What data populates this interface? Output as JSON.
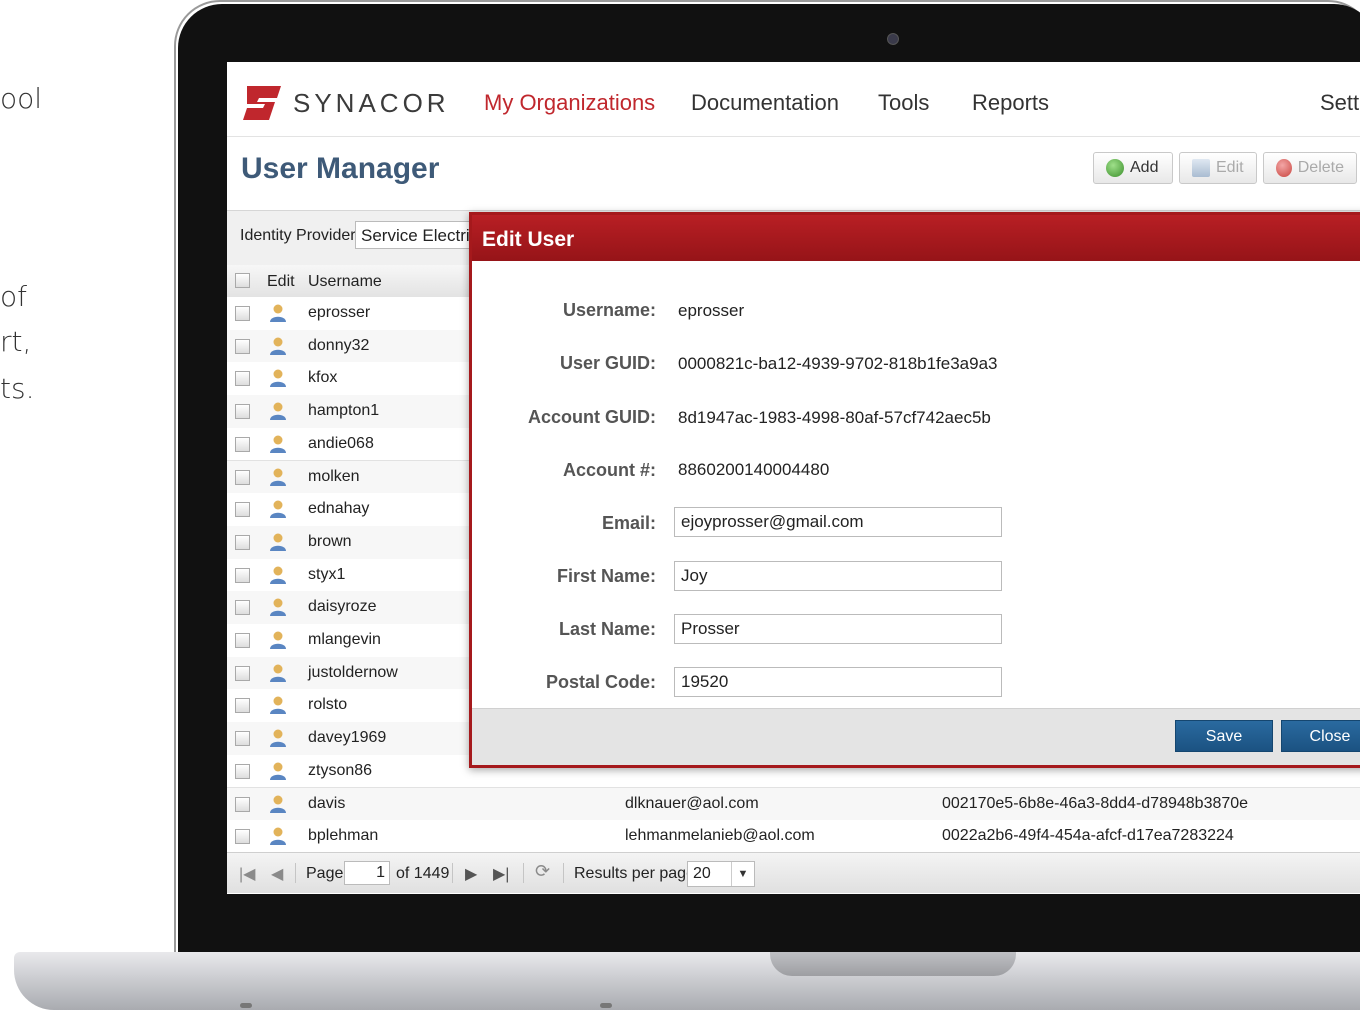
{
  "side_text": [
    "ool",
    "of",
    "rt,",
    "ts."
  ],
  "nav": {
    "logo_text": "SYNACOR",
    "items": [
      "My Organizations",
      "Documentation",
      "Tools",
      "Reports",
      "Sett"
    ],
    "active_color": "#c0272d"
  },
  "page": {
    "title": "User Manager",
    "toolbar": {
      "add": "Add",
      "edit": "Edit",
      "delete": "Delete"
    }
  },
  "grid": {
    "identity_provider_label": "Identity Provider:",
    "identity_provider_value": "Service Electric",
    "headers": {
      "edit": "Edit",
      "username": "Username"
    },
    "rows": [
      {
        "username": "eprosser",
        "email": "",
        "guid": ""
      },
      {
        "username": "donny32",
        "email": "",
        "guid": ""
      },
      {
        "username": "kfox",
        "email": "",
        "guid": ""
      },
      {
        "username": "hampton1",
        "email": "",
        "guid": ""
      },
      {
        "username": "andie068",
        "email": "",
        "guid": ""
      },
      {
        "username": "molken",
        "email": "",
        "guid": ""
      },
      {
        "username": "ednahay",
        "email": "",
        "guid": ""
      },
      {
        "username": "brown",
        "email": "",
        "guid": ""
      },
      {
        "username": "styx1",
        "email": "",
        "guid": ""
      },
      {
        "username": "daisyroze",
        "email": "",
        "guid": ""
      },
      {
        "username": "mlangevin",
        "email": "",
        "guid": ""
      },
      {
        "username": "justoldernow",
        "email": "",
        "guid": ""
      },
      {
        "username": "rolsto",
        "email": "",
        "guid": ""
      },
      {
        "username": "davey1969",
        "email": "",
        "guid": ""
      },
      {
        "username": "ztyson86",
        "email": "",
        "guid": ""
      },
      {
        "username": "davis",
        "email": "dlknauer@aol.com",
        "guid": "002170e5-6b8e-46a3-8dd4-d78948b3870e"
      },
      {
        "username": "bplehman",
        "email": "lehmanmelanieb@aol.com",
        "guid": "0022a2b6-49f4-454a-afcf-d17ea7283224"
      }
    ]
  },
  "pager": {
    "page_label": "Page",
    "page_value": "1",
    "of_total": "of 1449",
    "results_label": "Results per page",
    "results_value": "20"
  },
  "modal": {
    "title": "Edit User",
    "fields": {
      "username_label": "Username:",
      "username_value": "eprosser",
      "user_guid_label": "User GUID:",
      "user_guid_value": "0000821c-ba12-4939-9702-818b1fe3a9a3",
      "account_guid_label": "Account GUID:",
      "account_guid_value": "8d1947ac-1983-4998-80af-57cf742aec5b",
      "account_num_label": "Account #:",
      "account_num_value": "8860200140004480",
      "email_label": "Email:",
      "email_value": "ejoyprosser@gmail.com",
      "first_name_label": "First Name:",
      "first_name_value": "Joy",
      "last_name_label": "Last Name:",
      "last_name_value": "Prosser",
      "postal_label": "Postal Code:",
      "postal_value": "19520"
    },
    "save": "Save",
    "close": "Close"
  },
  "colors": {
    "brand_red": "#c0272d",
    "modal_header": "#a5191c",
    "title_blue": "#3e5a78",
    "button_blue": "#1b5282"
  }
}
